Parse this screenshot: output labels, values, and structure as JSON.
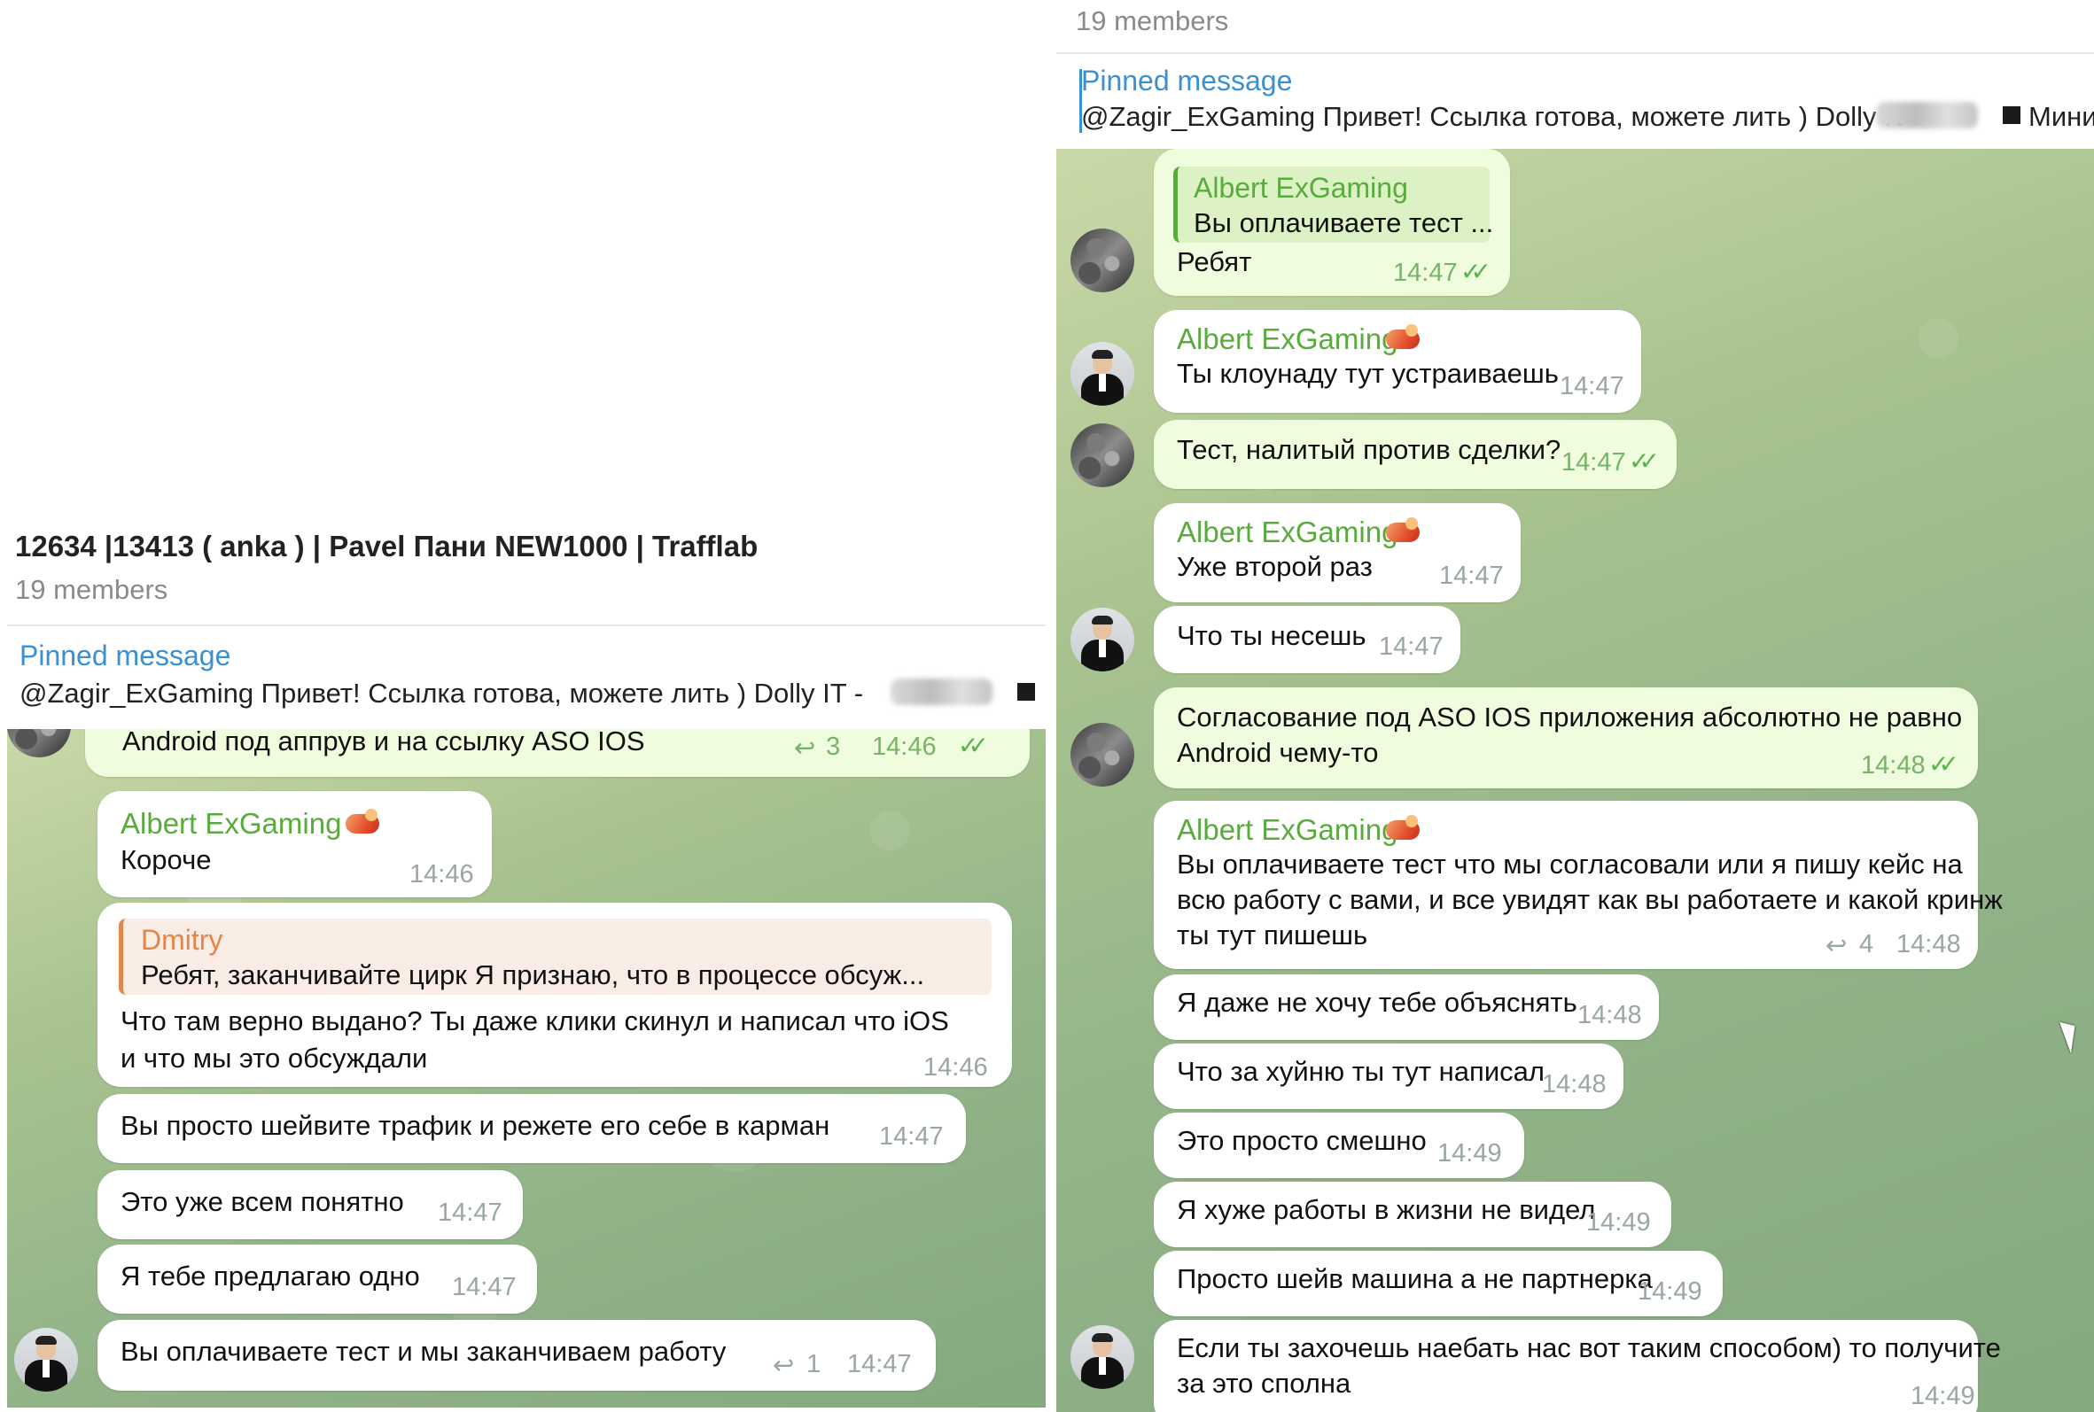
{
  "left": {
    "title": "12634 |13413 ( anka ) | Pavel Пани NEW1000 | Trafflab",
    "members": "19 members",
    "pinned": {
      "label": "Pinned message",
      "text": "@Zagir_ExGaming Привет! Ссылка готова, можете лить )   Dolly IT -"
    },
    "messages": {
      "m0": {
        "text": "Android под аппрув и на ссылку ASO IOS",
        "replies": "3",
        "time": "14:46"
      },
      "m1": {
        "sender": "Albert ExGaming",
        "text": "Короче",
        "time": "14:46"
      },
      "m2": {
        "quote_name": "Dmitry",
        "quote_text": "Ребят, заканчивайте цирк Я признаю, что в процессе обсуж...",
        "line1": "Что там верно выдано? Ты даже клики скинул и написал что iOS",
        "line2": "и что мы это обсуждали",
        "time": "14:46"
      },
      "m3": {
        "text": "Вы просто шейвите трафик и режете его себе в карман",
        "time": "14:47"
      },
      "m4": {
        "text": "Это уже всем понятно",
        "time": "14:47"
      },
      "m5": {
        "text": "Я тебе предлагаю одно",
        "time": "14:47"
      },
      "m6": {
        "text": "Вы оплачиваете тест и мы заканчиваем работу",
        "replies": "1",
        "time": "14:47"
      }
    }
  },
  "right": {
    "members": "19 members",
    "pinned": {
      "label": "Pinned message",
      "text": "@Zagir_ExGaming Привет! Ссылка готова, можете лить )   Dolly IT -",
      "tail": "Мини"
    },
    "messages": {
      "r1": {
        "quote_name": "Albert ExGaming",
        "quote_text": "Вы оплачиваете тест ...",
        "text": "Ребят",
        "time": "14:47"
      },
      "r2": {
        "sender": "Albert ExGaming",
        "text": "Ты клоунаду тут устраиваешь",
        "time": "14:47"
      },
      "r3": {
        "text": "Тест, налитый против сделки?",
        "time": "14:47"
      },
      "r4": {
        "sender": "Albert ExGaming",
        "text": "Уже второй раз",
        "time": "14:47"
      },
      "r5": {
        "text": "Что ты несешь",
        "time": "14:47"
      },
      "r6": {
        "line1": "Согласование под ASO IOS приложения абсолютно не равно",
        "line2": "Android чему-то",
        "time": "14:48"
      },
      "r7": {
        "sender": "Albert ExGaming",
        "line1": "Вы оплачиваете тест что мы согласовали или я пишу кейс на",
        "line2": "всю работу с вами, и все увидят как вы работаете и какой кринж",
        "line3": "ты тут пишешь",
        "replies": "4",
        "time": "14:48"
      },
      "r8": {
        "text": "Я даже не хочу тебе объяснять",
        "time": "14:48"
      },
      "r9": {
        "text": "Что за хуйню ты тут написал",
        "time": "14:48"
      },
      "r10": {
        "text": "Это просто смешно",
        "time": "14:49"
      },
      "r11": {
        "text": "Я хуже работы в жизни не видел",
        "time": "14:49"
      },
      "r12": {
        "text": "Просто шейв машина а не партнерка",
        "time": "14:49"
      },
      "r13": {
        "line1": "Если ты захочешь наебать нас вот таким способом) то получите",
        "line2": "за это сполна",
        "time": "14:49"
      }
    }
  },
  "colors": {
    "sender_name": "#5aab3d",
    "pinned_accent": "#3a90d0",
    "incoming_bubble": "#ffffff",
    "outgoing_bubble": "#effdde",
    "chat_background": "#a8c38f",
    "reply_quote_dmitry": "#e1874a"
  },
  "icons": [
    "reply-arrow-icon",
    "double-check-icon",
    "pin-square-icon",
    "handshake-emoji-icon",
    "mouse-cursor-icon"
  ]
}
